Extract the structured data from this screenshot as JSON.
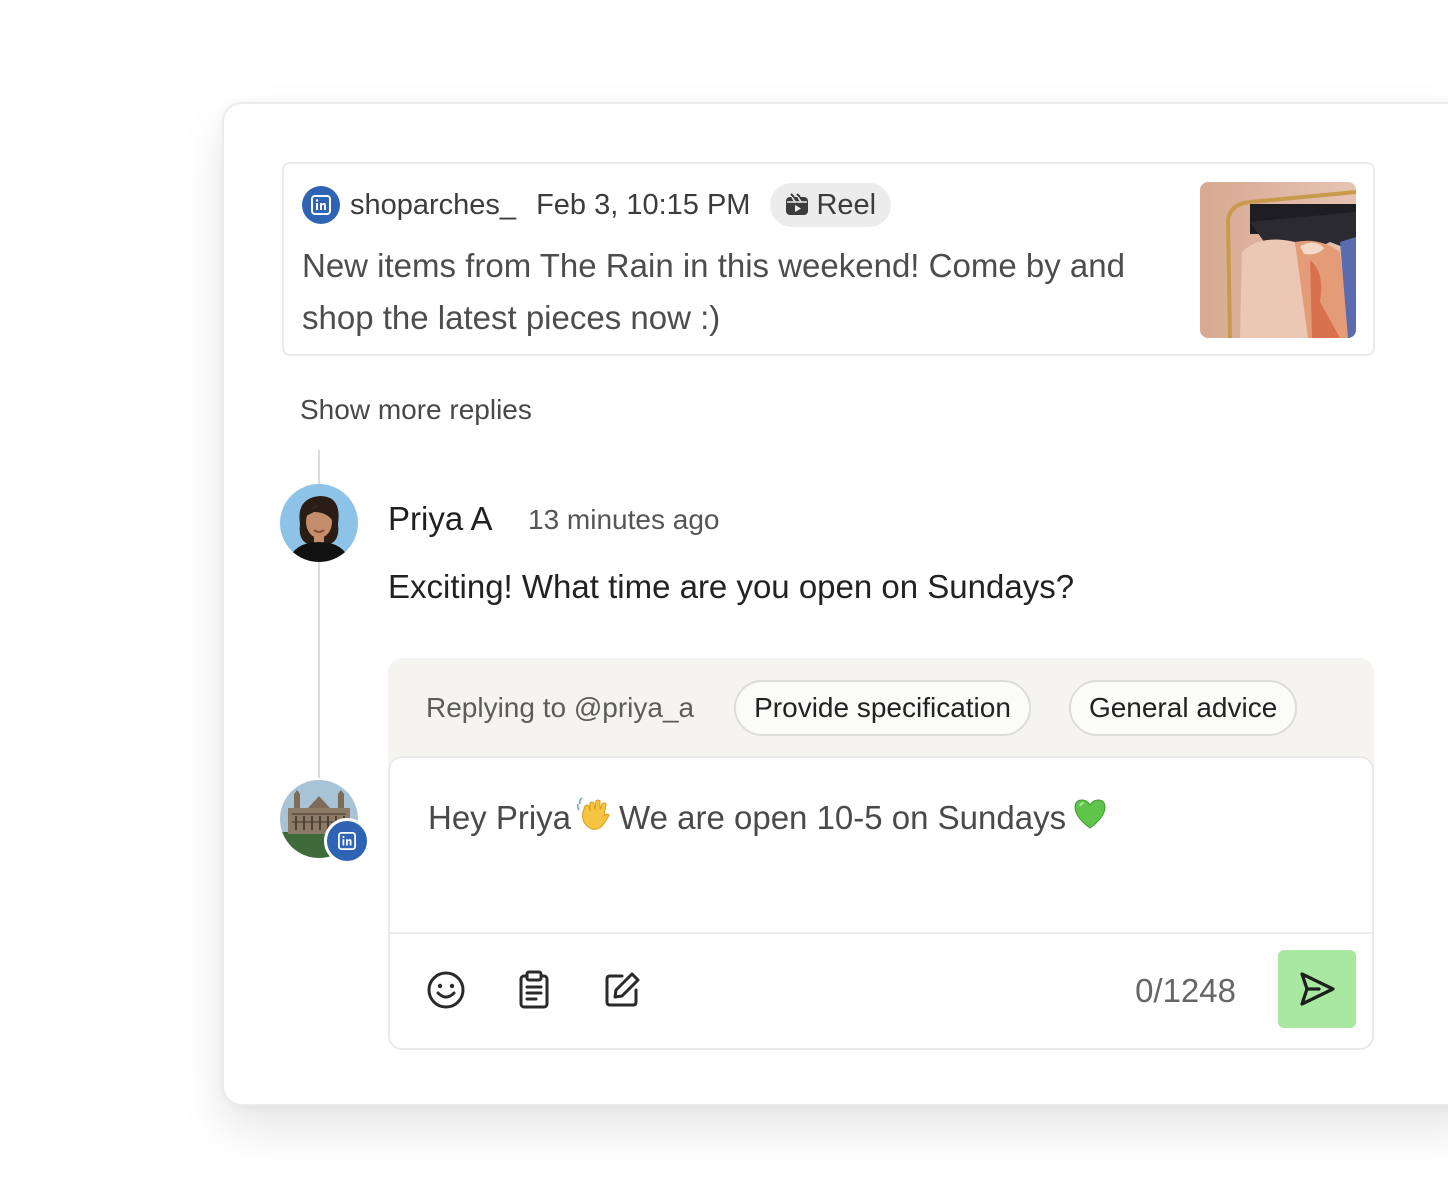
{
  "post": {
    "platform_icon": "linkedin-icon",
    "author": "shoparches_",
    "date": "Feb 3, 10:15 PM",
    "type_label": "Reel",
    "text": "New items from The Rain in this weekend! Come by and shop the latest pieces now :)"
  },
  "thread": {
    "show_more_label": "Show more replies"
  },
  "comment": {
    "author": "Priya A",
    "time": "13 minutes ago",
    "text": "Exciting! What time are you open on Sundays?"
  },
  "reply": {
    "replying_to": "Replying to @priya_a",
    "suggestions": [
      "Provide specification",
      "General advice"
    ],
    "draft_part1": "Hey Priya",
    "draft_part2": "We are open 10-5 on Sundays",
    "char_count": "0/1248",
    "tools": [
      "emoji-icon",
      "clipboard-icon",
      "edit-icon"
    ],
    "send_icon": "send-icon"
  },
  "colors": {
    "linkedin_blue": "#2e64b3",
    "send_button": "#a8e8a0",
    "panel_bg": "#f5f4f1"
  }
}
